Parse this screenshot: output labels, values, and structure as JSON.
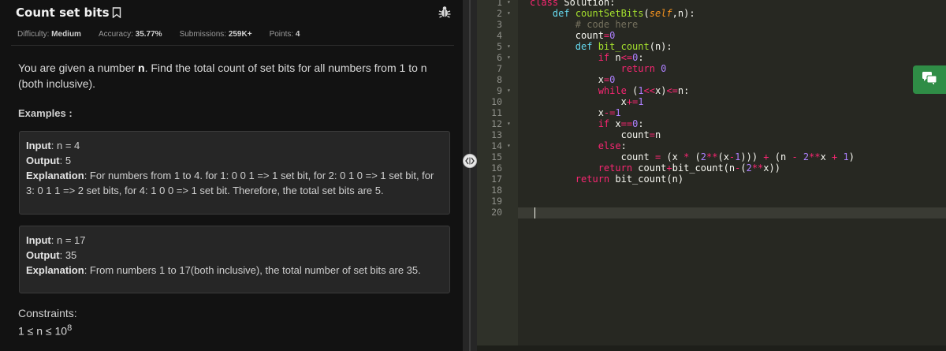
{
  "problem": {
    "title": "Count set bits",
    "difficulty_label": "Difficulty:",
    "difficulty": "Medium",
    "accuracy_label": "Accuracy:",
    "accuracy": "35.77%",
    "submissions_label": "Submissions:",
    "submissions": "259K+",
    "points_label": "Points:",
    "points": "4",
    "desc_pre": "You are given a number ",
    "desc_bold": "n",
    "desc_post": ". Find the total count of set bits for all numbers from 1 to n (both inclusive).",
    "examples_heading": "Examples :",
    "example1": {
      "input_label": "Input",
      "input": ": n = 4",
      "output_label": "Output",
      "output": ": 5",
      "explanation_label": "Explanation",
      "explanation": ": For numbers from 1 to 4. for 1: 0 0 1 => 1 set bit, for 2: 0 1 0 => 1 set bit, for 3: 0 1 1 => 2 set bits, for 4: 1 0 0 => 1 set bit. Therefore, the total set bits are 5."
    },
    "example2": {
      "input_label": "Input",
      "input": ": n = 17",
      "output_label": "Output",
      "output": ": 35",
      "explanation_label": "Explanation",
      "explanation": ": From numbers 1 to 17(both inclusive), the total number of set bits are 35."
    },
    "constraints_heading": "Constraints:",
    "constraint_base": "1 ≤ n ≤ 10",
    "constraint_exp": "8"
  },
  "editor": {
    "line_numbers": [
      "1",
      "2",
      "3",
      "4",
      "5",
      "6",
      "7",
      "8",
      "9",
      "10",
      "11",
      "12",
      "13",
      "14",
      "15",
      "16",
      "17",
      "18",
      "19",
      "20"
    ],
    "fold_lines": [
      1,
      2,
      5,
      6,
      9,
      12,
      14
    ],
    "lines": [
      [
        {
          "t": "class ",
          "c": "k"
        },
        {
          "t": "Solution:",
          "c": ""
        }
      ],
      [
        {
          "t": "    ",
          "c": ""
        },
        {
          "t": "def ",
          "c": "s"
        },
        {
          "t": "countSetBits",
          "c": "f"
        },
        {
          "t": "(",
          "c": ""
        },
        {
          "t": "self",
          "c": "sf"
        },
        {
          "t": ",n):",
          "c": ""
        }
      ],
      [
        {
          "t": "        ",
          "c": ""
        },
        {
          "t": "# code here",
          "c": "c"
        }
      ],
      [
        {
          "t": "        count",
          "c": ""
        },
        {
          "t": "=",
          "c": "k"
        },
        {
          "t": "0",
          "c": "m"
        }
      ],
      [
        {
          "t": "        ",
          "c": ""
        },
        {
          "t": "def ",
          "c": "s"
        },
        {
          "t": "bit_count",
          "c": "f"
        },
        {
          "t": "(n):",
          "c": ""
        }
      ],
      [
        {
          "t": "            ",
          "c": ""
        },
        {
          "t": "if ",
          "c": "k"
        },
        {
          "t": "n",
          "c": ""
        },
        {
          "t": "<=",
          "c": "k"
        },
        {
          "t": "0",
          "c": "m"
        },
        {
          "t": ":",
          "c": ""
        }
      ],
      [
        {
          "t": "                ",
          "c": ""
        },
        {
          "t": "return ",
          "c": "k"
        },
        {
          "t": "0",
          "c": "m"
        }
      ],
      [
        {
          "t": "            x",
          "c": ""
        },
        {
          "t": "=",
          "c": "k"
        },
        {
          "t": "0",
          "c": "m"
        }
      ],
      [
        {
          "t": "            ",
          "c": ""
        },
        {
          "t": "while ",
          "c": "k"
        },
        {
          "t": "(",
          "c": ""
        },
        {
          "t": "1",
          "c": "m"
        },
        {
          "t": "<<",
          "c": "k"
        },
        {
          "t": "x)",
          "c": ""
        },
        {
          "t": "<=",
          "c": "k"
        },
        {
          "t": "n:",
          "c": ""
        }
      ],
      [
        {
          "t": "                x",
          "c": ""
        },
        {
          "t": "+=",
          "c": "k"
        },
        {
          "t": "1",
          "c": "m"
        }
      ],
      [
        {
          "t": "            x",
          "c": ""
        },
        {
          "t": "-=",
          "c": "k"
        },
        {
          "t": "1",
          "c": "m"
        }
      ],
      [
        {
          "t": "            ",
          "c": ""
        },
        {
          "t": "if ",
          "c": "k"
        },
        {
          "t": "x",
          "c": ""
        },
        {
          "t": "==",
          "c": "k"
        },
        {
          "t": "0",
          "c": "m"
        },
        {
          "t": ":",
          "c": ""
        }
      ],
      [
        {
          "t": "                count",
          "c": ""
        },
        {
          "t": "=",
          "c": "k"
        },
        {
          "t": "n",
          "c": ""
        }
      ],
      [
        {
          "t": "            ",
          "c": ""
        },
        {
          "t": "else",
          "c": "k"
        },
        {
          "t": ":",
          "c": ""
        }
      ],
      [
        {
          "t": "                count ",
          "c": ""
        },
        {
          "t": "= ",
          "c": "k"
        },
        {
          "t": "(x ",
          "c": ""
        },
        {
          "t": "* ",
          "c": "k"
        },
        {
          "t": "(",
          "c": ""
        },
        {
          "t": "2",
          "c": "m"
        },
        {
          "t": "**",
          "c": "k"
        },
        {
          "t": "(x",
          "c": ""
        },
        {
          "t": "-",
          "c": "k"
        },
        {
          "t": "1",
          "c": "m"
        },
        {
          "t": "))) ",
          "c": ""
        },
        {
          "t": "+ ",
          "c": "k"
        },
        {
          "t": "(n ",
          "c": ""
        },
        {
          "t": "- ",
          "c": "k"
        },
        {
          "t": "2",
          "c": "m"
        },
        {
          "t": "**",
          "c": "k"
        },
        {
          "t": "x ",
          "c": ""
        },
        {
          "t": "+ ",
          "c": "k"
        },
        {
          "t": "1",
          "c": "m"
        },
        {
          "t": ")",
          "c": ""
        }
      ],
      [
        {
          "t": "            ",
          "c": ""
        },
        {
          "t": "return ",
          "c": "k"
        },
        {
          "t": "count",
          "c": ""
        },
        {
          "t": "+",
          "c": "k"
        },
        {
          "t": "bit_count(n",
          "c": ""
        },
        {
          "t": "-",
          "c": "k"
        },
        {
          "t": "(",
          "c": ""
        },
        {
          "t": "2",
          "c": "m"
        },
        {
          "t": "**",
          "c": "k"
        },
        {
          "t": "x))",
          "c": ""
        }
      ],
      [
        {
          "t": "        ",
          "c": ""
        },
        {
          "t": "return ",
          "c": "k"
        },
        {
          "t": "bit_count(n)",
          "c": ""
        }
      ],
      [
        {
          "t": "",
          "c": ""
        }
      ],
      [
        {
          "t": "",
          "c": ""
        }
      ],
      [
        {
          "t": "",
          "c": ""
        }
      ]
    ]
  },
  "colors": {
    "accent_green": "#2f8d46",
    "editor_bg": "#272822",
    "panel_bg": "#121212"
  }
}
